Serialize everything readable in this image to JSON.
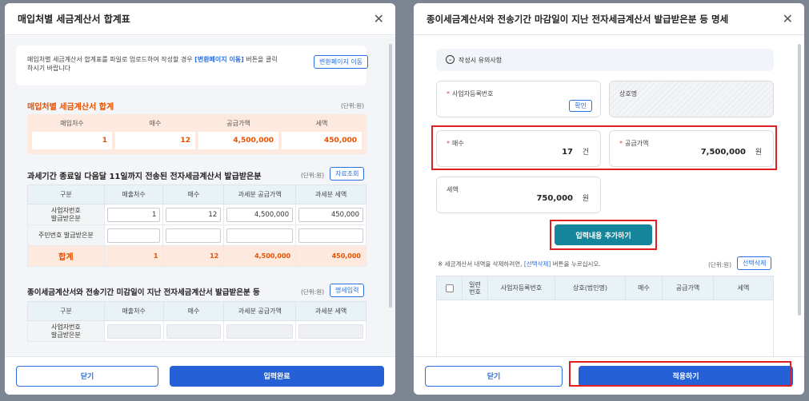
{
  "left": {
    "title": "매입처별 세금계산서 합계표",
    "notice": {
      "text_before": "매입처별 세금계산서 합계표를 파일로 업로드하여 작성할 경우 ",
      "text_link": "[변환페이지 이동]",
      "text_after": " 버튼을 클릭하시기 바랍니다",
      "button": "변환페이지 이동"
    },
    "summary": {
      "title": "매입처별 세금계산서 합계",
      "unit": "(단위:원)",
      "headers": [
        "매입처수",
        "매수",
        "공급가액",
        "세액"
      ],
      "values": [
        "1",
        "12",
        "4,500,000",
        "450,000"
      ]
    },
    "section1": {
      "title_pre": "과세기간 종료일 다음달 ",
      "title_bold": "11일",
      "title_post": "까지 전송된 전자세금계산서 발급받은분",
      "unit": "(단위:원)",
      "button": "자료조회",
      "headers": [
        "구분",
        "매출처수",
        "매수",
        "과세분 공급가액",
        "과세분 세액"
      ],
      "rows": [
        {
          "label": "사업자번호\n발급받은분",
          "cells": [
            "1",
            "12",
            "4,500,000",
            "450,000"
          ]
        },
        {
          "label": "주민번호 발급받은분",
          "cells": [
            "",
            "",
            "",
            ""
          ]
        }
      ],
      "total": {
        "label": "합계",
        "cells": [
          "1",
          "12",
          "4,500,000",
          "450,000"
        ]
      }
    },
    "section2": {
      "title": "종이세금계산서와 전송기간 미감일이 지난 전자세금계산서 발급받은분 등",
      "unit": "(단위:원)",
      "button": "명세입력",
      "headers": [
        "구분",
        "매출처수",
        "매수",
        "과세분 공급가액",
        "과세분 세액"
      ],
      "rows": [
        {
          "label": "사업자번호\n발급받은분"
        }
      ]
    },
    "footer": {
      "close": "닫기",
      "submit": "입력완료"
    }
  },
  "right": {
    "title": "종이세금계산서와 전송기간 마감일이 지난 전자세금계산서 발급받은분 등 명세",
    "notes_label": "작성시 유의사항",
    "fields": {
      "bizno_label": "사업자등록번호",
      "confirm": "확인",
      "company_label": "상호명",
      "count_label": "매수",
      "count_value": "17",
      "count_unit": "건",
      "supply_label": "공급가액",
      "supply_value": "7,500,000",
      "supply_unit": "원",
      "tax_label": "세액",
      "tax_value": "750,000",
      "tax_unit": "원"
    },
    "add_button": "입력내용 추가하기",
    "delete_note_pre": "※ 세금계산서 내역을 삭제하려면, ",
    "delete_note_link": "[선택삭제]",
    "delete_note_post": " 버튼을 누르십시오.",
    "unit": "(단위:원)",
    "delete_button": "선택삭제",
    "table_headers": [
      "일련\n번호",
      "사업자등록번호",
      "상호(법인명)",
      "매수",
      "공급가액",
      "세액"
    ],
    "footer": {
      "close": "닫기",
      "apply": "적용하기"
    }
  },
  "colors": {
    "accent": "#2560d6",
    "teal": "#14859a",
    "orange": "#e65100",
    "highlight": "#e02020"
  }
}
